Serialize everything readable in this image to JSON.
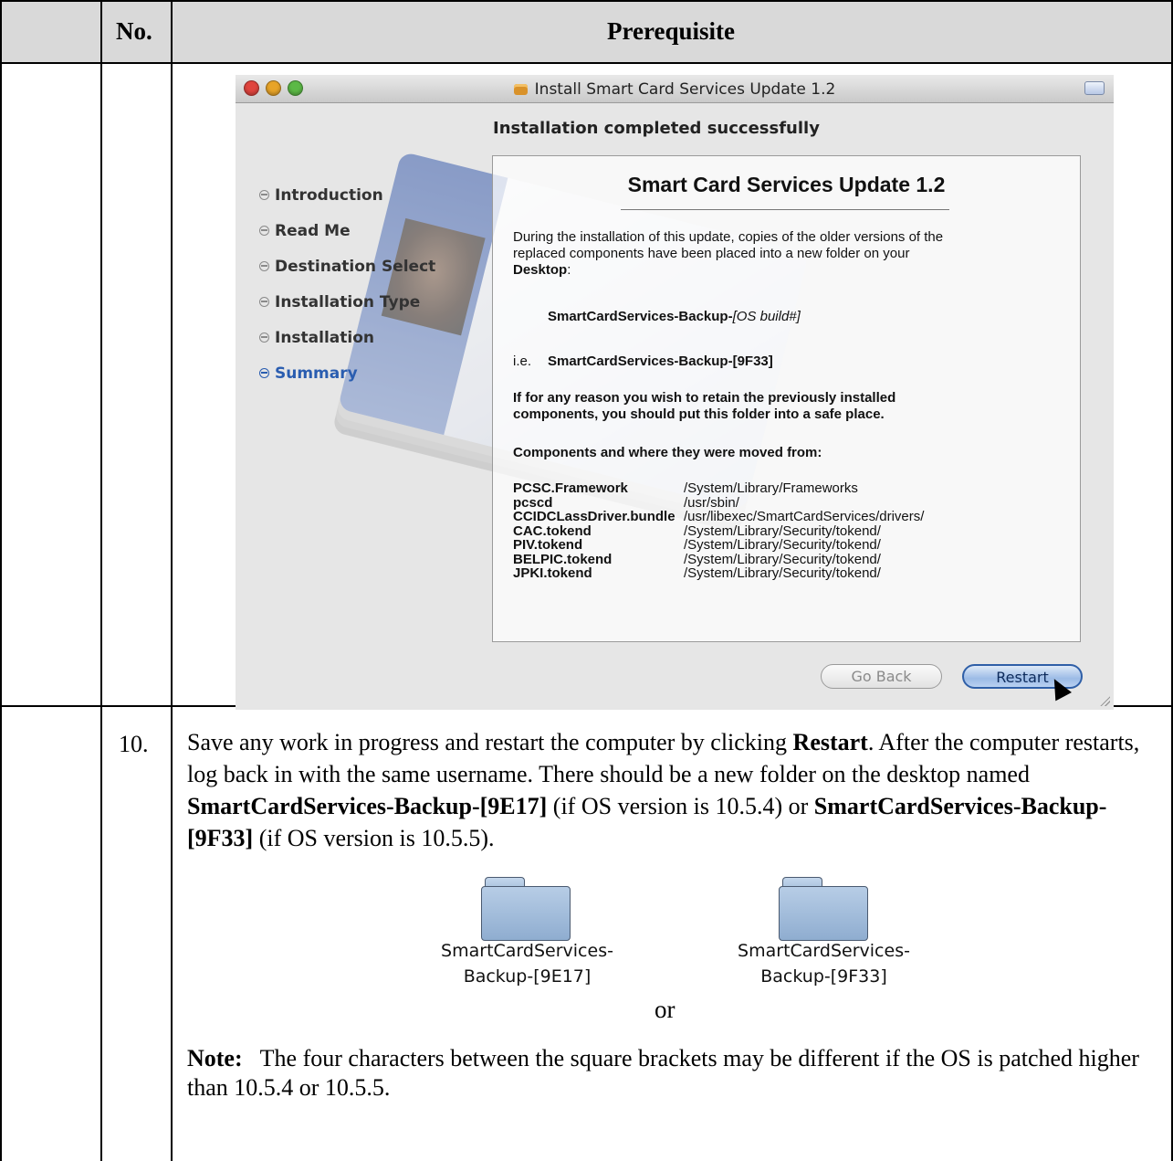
{
  "table": {
    "header": {
      "col_no": "No.",
      "col_prerequisite": "Prerequisite"
    }
  },
  "installer": {
    "window_title": "Install Smart Card Services Update 1.2",
    "section_title": "Installation completed successfully",
    "steps": [
      {
        "label": "Introduction",
        "active": false
      },
      {
        "label": "Read Me",
        "active": false
      },
      {
        "label": "Destination Select",
        "active": false
      },
      {
        "label": "Installation Type",
        "active": false
      },
      {
        "label": "Installation",
        "active": false
      },
      {
        "label": "Summary",
        "active": true
      }
    ],
    "panel": {
      "title": "Smart Card Services Update 1.2",
      "intro_line1": "During the installation of this update, copies of the older versions of the",
      "intro_line2": "replaced components have been placed into a new folder on your",
      "intro_line3": "Desktop",
      "intro_line3_suffix": ":",
      "backup_name": "SmartCardServices-Backup-",
      "backup_suffix": "[OS build#]",
      "ie_prefix": "i.e.",
      "ie_example": "SmartCardServices-Backup-[9F33]",
      "retain_line1": "If for any reason you wish to retain the previously installed",
      "retain_line2": "components, you should put this folder into a safe place.",
      "components_heading": "Components and where they were moved from:",
      "components": [
        {
          "name": "PCSC.Framework",
          "path": "/System/Library/Frameworks"
        },
        {
          "name": "pcscd",
          "path": "/usr/sbin/"
        },
        {
          "name": "CCIDCLassDriver.bundle",
          "path": "/usr/libexec/SmartCardServices/drivers/"
        },
        {
          "name": "CAC.tokend",
          "path": "/System/Library/Security/tokend/"
        },
        {
          "name": "PIV.tokend",
          "path": "/System/Library/Security/tokend/"
        },
        {
          "name": "BELPIC.tokend",
          "path": "/System/Library/Security/tokend/"
        },
        {
          "name": "JPKI.tokend",
          "path": "/System/Library/Security/tokend/"
        }
      ]
    },
    "buttons": {
      "go_back": "Go Back",
      "restart": "Restart"
    },
    "accent_color": "#2a5db0"
  },
  "row10": {
    "number": "10.",
    "text_1": "Save any work in progress and restart the computer by clicking ",
    "bold_restart": "Restart",
    "text_2": ".  After the computer restarts, log back in with the same username.  There should be a new folder on the desktop named ",
    "bold_backup_9e17": "SmartCardServices-Backup-[9E17]",
    "text_3": " (if OS version is 10.5.4) or ",
    "bold_backup_9f33": "SmartCardServices-Backup-[9F33]",
    "text_4": " (if OS version is 10.5.5).",
    "folders": [
      {
        "line1": "SmartCardServices-",
        "line2": "Backup-[9E17]"
      },
      {
        "line1": "SmartCardServices-",
        "line2": "Backup-[9F33]"
      }
    ],
    "or_text": "or",
    "note_label": "Note:",
    "note_text": "   The four characters between the square brackets may be different if the OS is patched higher than 10.5.4 or 10.5.5."
  }
}
